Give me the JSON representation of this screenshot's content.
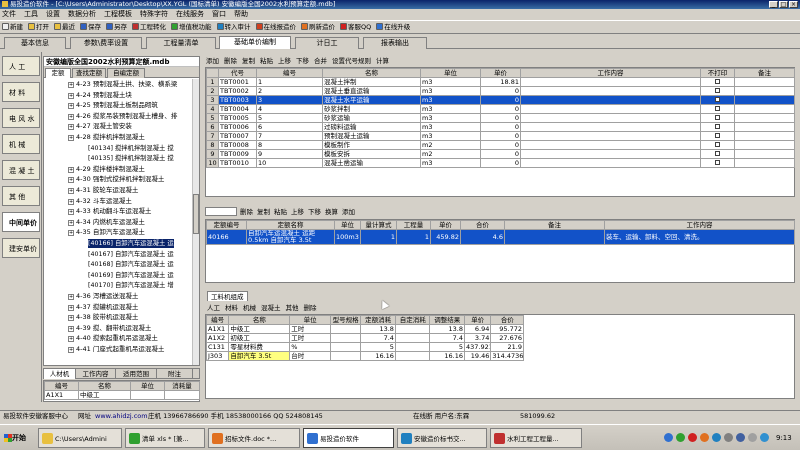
{
  "window": {
    "title": "易投造价软件 - [C:\\Users\\Administrator\\Desktop\\XX.YGL (国标清单) 安徽编版全国2002水利预算定额.mdb]",
    "minimize": "_",
    "maximize": "□",
    "close": "×"
  },
  "menu": [
    "文件",
    "工具",
    "设置",
    "数据分析",
    "工程模板",
    "特殊字符",
    "在线服务",
    "窗口",
    "帮助"
  ],
  "toolbar": [
    {
      "label": "新建",
      "color": "#f0f0f0",
      "icon": "new-icon"
    },
    {
      "label": "打开",
      "color": "#e8c040",
      "icon": "open-icon"
    },
    {
      "label": "最近",
      "color": "#e8c040",
      "icon": "recent-icon"
    },
    {
      "label": "保存",
      "color": "#3060c0",
      "icon": "save-icon"
    },
    {
      "label": "另存",
      "color": "#3060c0",
      "icon": "save-as-icon"
    },
    {
      "label": "工程转化",
      "color": "#c03030",
      "icon": "convert-icon"
    },
    {
      "label": "增值税功能",
      "color": "#30a030",
      "icon": "vat-icon"
    },
    {
      "label": "转入审计",
      "color": "#2080c0",
      "icon": "audit-icon"
    },
    {
      "label": "在线报造价",
      "color": "#d04020",
      "icon": "online-price-icon"
    },
    {
      "label": "刷新造价",
      "color": "#e07020",
      "icon": "refresh-icon"
    },
    {
      "label": "客服QQ",
      "color": "#d02020",
      "icon": "qq-icon"
    },
    {
      "label": "在线升级",
      "color": "#3070d0",
      "icon": "upgrade-icon"
    }
  ],
  "tabs": [
    "基本信息",
    "参数\\费率设置",
    "工程量清单",
    "基础单价编制",
    "计日工",
    "报表输出"
  ],
  "active_tab": 3,
  "side_nav": [
    "人 工",
    "材 料",
    "电 风 水",
    "机 械",
    "混 凝 土",
    "其 他",
    "中间单价",
    "建安单价"
  ],
  "active_side": 6,
  "tree": {
    "title": "安徽编版全国2002水利预算定额.mdb",
    "tabs": [
      "定额",
      "查找定额",
      "自编定额"
    ],
    "rows": [
      {
        "text": "4-23 预制混凝土拱、扶梁、横系梁",
        "indent": 1,
        "type": "exp"
      },
      {
        "text": "4-24 预制混凝土块",
        "indent": 1,
        "type": "exp"
      },
      {
        "text": "4-25 预制混凝土板制品砌筑",
        "indent": 1,
        "type": "exp"
      },
      {
        "text": "4-26 搅浆吊装预制混凝土槽身、排",
        "indent": 1,
        "type": "exp"
      },
      {
        "text": "4-27 混凝土管安装",
        "indent": 1,
        "type": "exp"
      },
      {
        "text": "4-28 搅拌机拌制混凝土",
        "indent": 1,
        "type": "exp"
      },
      {
        "text": "[40134] 搅拌机拌制混凝土 搅",
        "indent": 2,
        "type": "leaf"
      },
      {
        "text": "[40135] 搅拌机拌制混凝土 搅",
        "indent": 2,
        "type": "leaf"
      },
      {
        "text": "4-29 搅拌楼拌制混凝土",
        "indent": 1,
        "type": "exp"
      },
      {
        "text": "4-30 强制式搅拌机拌制混凝土",
        "indent": 1,
        "type": "exp"
      },
      {
        "text": "4-31 胶轮车运混凝土",
        "indent": 1,
        "type": "exp"
      },
      {
        "text": "4-32 斗车运混凝土",
        "indent": 1,
        "type": "exp"
      },
      {
        "text": "4-33 机动翻斗车运混凝土",
        "indent": 1,
        "type": "exp"
      },
      {
        "text": "4-34 内燃机车运混凝土",
        "indent": 1,
        "type": "exp"
      },
      {
        "text": "4-35 自卸汽车运混凝土",
        "indent": 1,
        "type": "exp"
      },
      {
        "text": "[40166] 自卸汽车运混凝土 运",
        "indent": 2,
        "type": "leaf",
        "selected": true
      },
      {
        "text": "[40167] 自卸汽车运混凝土 运",
        "indent": 2,
        "type": "leaf"
      },
      {
        "text": "[40168] 自卸汽车运混凝土 运",
        "indent": 2,
        "type": "leaf"
      },
      {
        "text": "[40169] 自卸汽车运混凝土 运",
        "indent": 2,
        "type": "leaf"
      },
      {
        "text": "[40170] 自卸汽车运混凝土 增",
        "indent": 2,
        "type": "leaf"
      },
      {
        "text": "4-36 泻槽运送混凝土",
        "indent": 1,
        "type": "exp"
      },
      {
        "text": "4-37 搅罐机运混凝土",
        "indent": 1,
        "type": "exp"
      },
      {
        "text": "4-38 胶带机运混凝土",
        "indent": 1,
        "type": "exp"
      },
      {
        "text": "4-39 搅、翻带机运混凝土",
        "indent": 1,
        "type": "exp"
      },
      {
        "text": "4-40 搅索起重机吊运混凝土",
        "indent": 1,
        "type": "exp"
      },
      {
        "text": "4-41 门座式起重机吊运混凝土",
        "indent": 1,
        "type": "exp"
      }
    ]
  },
  "bottom_left": {
    "tabs": [
      "人材机",
      "工作内容",
      "适用范围",
      "附注"
    ],
    "headers": [
      "编号",
      "名称",
      "单位",
      "消耗量"
    ],
    "row": [
      "A1X1",
      "中级工",
      "",
      ""
    ]
  },
  "top_actions": [
    "添加",
    "删除",
    "复制",
    "粘贴",
    "上移",
    "下移",
    "合并",
    "设置代号规则",
    "计算"
  ],
  "top_table": {
    "headers": [
      "",
      "代号",
      "编号",
      "名称",
      "单位",
      "单价",
      "工作内容",
      "不打印",
      "备注"
    ],
    "rows": [
      [
        "1",
        "TBT0001",
        "1",
        "混凝土拌制",
        "m3",
        "18.81",
        "",
        false,
        ""
      ],
      [
        "2",
        "TBT0002",
        "2",
        "混凝土垂直运输",
        "m3",
        "0",
        "",
        false,
        ""
      ],
      [
        "3",
        "TBT0003",
        "3",
        "混凝土水平运输",
        "m3",
        "0",
        "",
        false,
        ""
      ],
      [
        "4",
        "TBT0004",
        "4",
        "砂浆拌制",
        "m3",
        "0",
        "",
        false,
        ""
      ],
      [
        "5",
        "TBT0005",
        "5",
        "砂浆运输",
        "m3",
        "0",
        "",
        false,
        ""
      ],
      [
        "6",
        "TBT0006",
        "6",
        "过磅料运输",
        "m3",
        "0",
        "",
        false,
        ""
      ],
      [
        "7",
        "TBT0007",
        "7",
        "预制混凝土运输",
        "m3",
        "0",
        "",
        false,
        ""
      ],
      [
        "8",
        "TBT0008",
        "8",
        "模板制作",
        "m2",
        "0",
        "",
        false,
        ""
      ],
      [
        "9",
        "TBT0009",
        "9",
        "模板安拆",
        "m2",
        "0",
        "",
        false,
        ""
      ],
      [
        "10",
        "TBT0010",
        "10",
        "混凝土凿运输",
        "m3",
        "0",
        "",
        false,
        ""
      ]
    ],
    "selected_row": 2
  },
  "mid_actions": [
    "删除",
    "复制",
    "粘贴",
    "上移",
    "下移",
    "换算",
    "添加"
  ],
  "quota_table": {
    "headers": [
      "定额编号",
      "定额名称",
      "单位",
      "量计算式",
      "工程量",
      "单价",
      "合价",
      "备注",
      "工作内容"
    ],
    "row": [
      "40166",
      "自卸汽车运混凝土 运距0.5km 自卸汽车 3.5t",
      "100m3",
      "1",
      "1",
      "459.82",
      "4.6",
      "",
      "装车、运输、卸料、空回、清洗。"
    ]
  },
  "resources": {
    "title": "工料机组成",
    "tabs": [
      "人工",
      "材料",
      "机械",
      "混凝土",
      "其他",
      "删除"
    ],
    "headers": [
      "编号",
      "名称",
      "单位",
      "型号规格",
      "定额消耗",
      "自定消耗",
      "调整结果",
      "单价",
      "合价"
    ],
    "rows": [
      [
        "A1X1",
        "中级工",
        "工时",
        "",
        "13.8",
        "",
        "13.8",
        "6.94",
        "95.772",
        false
      ],
      [
        "A1X2",
        "初级工",
        "工时",
        "",
        "7.4",
        "",
        "7.4",
        "3.74",
        "27.676",
        false
      ],
      [
        "C131",
        "零星材料费",
        "%",
        "",
        "5",
        "",
        "5",
        "437.921",
        "21.9",
        false
      ],
      [
        "J303",
        "自卸汽车 3.5t",
        "台时",
        "",
        "16.16",
        "",
        "16.16",
        "19.46",
        "314.4736",
        true
      ]
    ]
  },
  "status": {
    "company": "易投软件安徽客服中心",
    "website_label": "网址",
    "website": "www.ahidzj.com",
    "contact": "庄机 13966786690 手机 18538000166 QQ 524808145",
    "login": "在线断 用户名:东霖",
    "total": "581099.62"
  },
  "taskbar": {
    "start": "开始",
    "tasks": [
      {
        "label": "C:\\Users\\Admini",
        "color": "#e8c040",
        "active": false
      },
      {
        "label": "清单 xls * [兼...",
        "color": "#30a030",
        "active": false
      },
      {
        "label": "招标文件.doc *...",
        "color": "#e07020",
        "active": false
      },
      {
        "label": "易投造价软件",
        "color": "#3070d0",
        "active": true
      },
      {
        "label": "安徽造价标书交...",
        "color": "#2080c0",
        "active": false
      },
      {
        "label": "水利工程工程量...",
        "color": "#c03030",
        "active": false
      }
    ],
    "clock": "9:13"
  }
}
